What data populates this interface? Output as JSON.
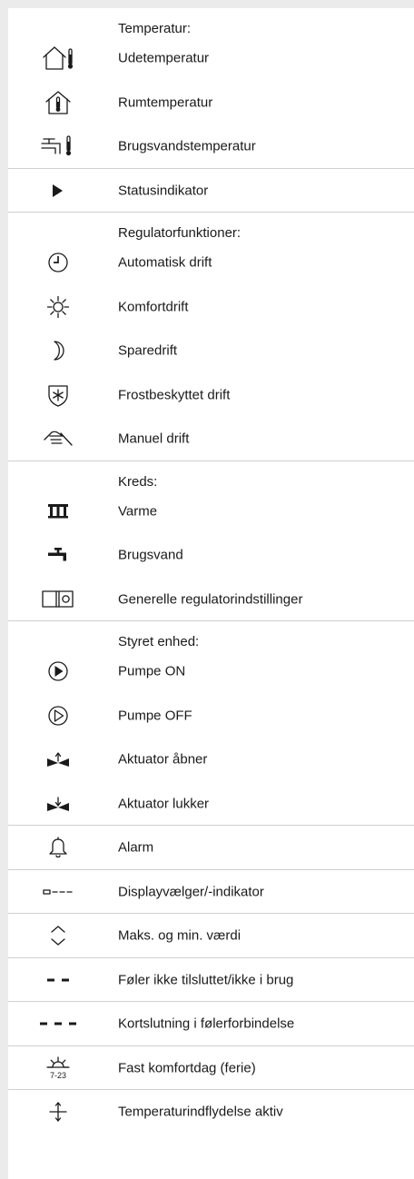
{
  "sections": [
    {
      "heading": "Temperatur:",
      "items": [
        {
          "icon": "house-thermometer-icon",
          "label": "Udetemperatur"
        },
        {
          "icon": "house-inner-thermometer-icon",
          "label": "Rumtemperatur"
        },
        {
          "icon": "tap-thermometer-icon",
          "label": "Brugsvandstemperatur"
        }
      ]
    },
    {
      "items": [
        {
          "icon": "play-triangle-icon",
          "label": "Statusindikator"
        }
      ]
    },
    {
      "heading": "Regulatorfunktioner:",
      "items": [
        {
          "icon": "clock-icon",
          "label": "Automatisk drift"
        },
        {
          "icon": "sun-icon",
          "label": "Komfortdrift"
        },
        {
          "icon": "moon-icon",
          "label": "Sparedrift"
        },
        {
          "icon": "frost-shield-icon",
          "label": "Frostbeskyttet drift"
        },
        {
          "icon": "hand-icon",
          "label": "Manuel drift"
        }
      ]
    },
    {
      "heading": "Kreds:",
      "items": [
        {
          "icon": "radiator-icon",
          "label": "Varme"
        },
        {
          "icon": "tap-icon",
          "label": "Brugsvand"
        },
        {
          "icon": "controller-box-icon",
          "label": "Generelle regulatorindstillinger"
        }
      ]
    },
    {
      "heading": "Styret enhed:",
      "items": [
        {
          "icon": "pump-on-icon",
          "label": "Pumpe ON"
        },
        {
          "icon": "pump-off-icon",
          "label": "Pumpe OFF"
        },
        {
          "icon": "valve-open-icon",
          "label": "Aktuator åbner"
        },
        {
          "icon": "valve-close-icon",
          "label": "Aktuator lukker"
        }
      ]
    },
    {
      "items": [
        {
          "icon": "bell-icon",
          "label": "Alarm"
        }
      ]
    },
    {
      "items": [
        {
          "icon": "display-selector-icon",
          "label": "Displayvælger/-indikator"
        }
      ]
    },
    {
      "items": [
        {
          "icon": "chevrons-up-down-icon",
          "label": "Maks. og min. værdi"
        }
      ]
    },
    {
      "items": [
        {
          "icon": "double-dash-icon",
          "label": "Føler ikke tilsluttet/ikke i brug"
        }
      ]
    },
    {
      "items": [
        {
          "icon": "triple-dash-icon",
          "label": "Kortslutning i følerforbindelse"
        }
      ]
    },
    {
      "items": [
        {
          "icon": "sun-holiday-icon",
          "label": "Fast komfortdag (ferie)",
          "icon_text": "7-23"
        }
      ]
    },
    {
      "items": [
        {
          "icon": "temperature-influence-icon",
          "label": "Temperaturindflydelse aktiv"
        }
      ]
    }
  ]
}
